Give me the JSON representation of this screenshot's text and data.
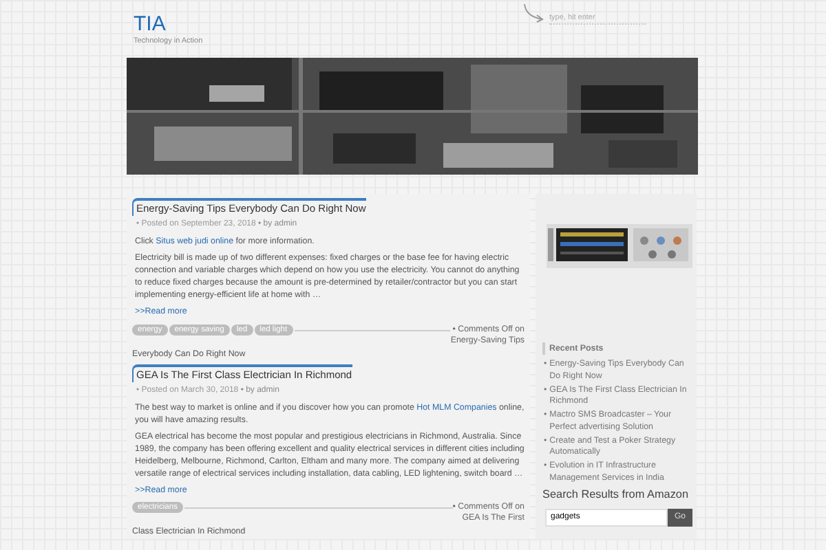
{
  "site": {
    "title": "TIA",
    "tagline": "Technology in Action"
  },
  "search": {
    "placeholder": "type, hit enter"
  },
  "posts": [
    {
      "title": "Energy-Saving Tips Everybody Can Do Right Now",
      "meta": "• Posted on September 23, 2018",
      "author": "• by admin",
      "intro_before": "Click ",
      "intro_link": "Situs web judi online",
      "intro_after": " for more information.",
      "body": "Electricity bill is made up of two different expenses: fixed charges or the base fee for having electric connection and variable charges which depend on how you use the electricity. You cannot do anything to reduce fixed charges because the amount is pre-determined by retailer/contractor but you can start implementing energy-efficient life at home with …",
      "read_more": ">>Read more",
      "tags": [
        "energy",
        "energy saving",
        "led",
        "led light"
      ],
      "comments": [
        "• Comments Off on",
        "Energy-Saving Tips"
      ],
      "trailing": "Everybody Can Do Right Now"
    },
    {
      "title": "GEA Is The First Class Electrician In Richmond",
      "meta": "• Posted on March 30, 2018",
      "author": "• by admin",
      "intro_before": "The best way to market is online and if you discover how you can promote ",
      "intro_link": "Hot MLM Companies",
      "intro_after": " online, you will have amazing results.",
      "body": "GEA electrical has become the most popular and prestigious electricians in Richmond, Australia. Since 1989, the company has been offering excellent and quality electrical services in different cities including Heidelberg, Melbourne, Richmond, Carlton, Eltham and many more. The company aimed at delivering versatile range of electrical services including installation, data cabling, LED lightening, switch board …",
      "read_more": ">>Read more",
      "tags": [
        "electricians"
      ],
      "comments": [
        "• Comments Off on",
        "GEA Is The First"
      ],
      "trailing": "Class Electrician In Richmond"
    }
  ],
  "sidebar": {
    "recent_posts": {
      "title": "Recent Posts",
      "marker": "•",
      "items": [
        "Energy-Saving Tips Everybody Can Do Right Now",
        "GEA Is The First Class Electrician In Richmond",
        "Mactro SMS Broadcaster – Your Perfect advertising Solution",
        "Create and Test a Poker Strategy Automatically",
        "Evolution in IT Infrastructure Management Services in India"
      ]
    },
    "amazon": {
      "title": "Search Results from Amazon",
      "value": "gadgets",
      "button": "Go"
    }
  }
}
